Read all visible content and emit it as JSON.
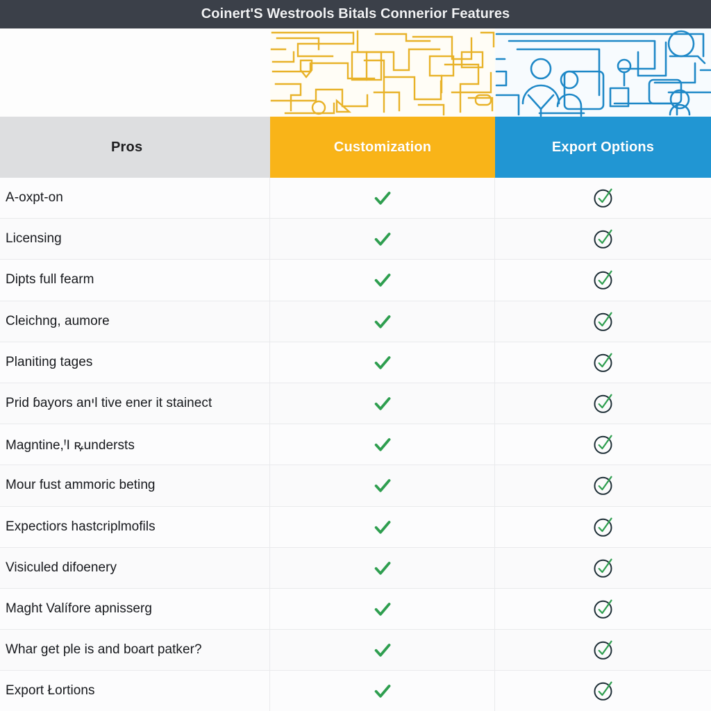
{
  "window": {
    "title": "Coinert'S Westrools Bitals Connerior Features"
  },
  "colors": {
    "titlebar_bg": "#3b4049",
    "pros_header_bg": "#dddee0",
    "customization_header_bg": "#f9b418",
    "export_header_bg": "#2196d3",
    "check_green": "#2e9e4f",
    "circle_outline": "#1a2b33",
    "banner_orange_line": "#e8b228",
    "banner_blue_line": "#1e88c7"
  },
  "banner": {
    "left_cell": "",
    "orange_art_name": "circuit-board-pattern",
    "blue_art_name": "people-network-pattern"
  },
  "table": {
    "columns": [
      {
        "key": "label",
        "label": "Pros",
        "name": "column-pros"
      },
      {
        "key": "custom",
        "label": "Customization",
        "name": "column-customization"
      },
      {
        "key": "export",
        "label": "Export Options",
        "name": "column-export-options"
      }
    ],
    "icons": {
      "customization": "check-icon",
      "export": "check-circle-icon"
    },
    "rows": [
      {
        "label": "A-oxpt-on",
        "custom": "check",
        "export": "check-circle"
      },
      {
        "label": "Licensing",
        "custom": "check",
        "export": "check-circle"
      },
      {
        "label": "Dipts full fearm",
        "custom": "check",
        "export": "check-circle"
      },
      {
        "label": "Cleichng, aumore",
        "custom": "check",
        "export": "check-circle"
      },
      {
        "label": "Planiting tages",
        "custom": "check",
        "export": "check-circle"
      },
      {
        "label": "Prid ɓayors anיl tive ener it stainect",
        "custom": "check",
        "export": "check-circle"
      },
      {
        "label": "Magntine,ꞋI ꝶundersts",
        "custom": "check",
        "export": "check-circle"
      },
      {
        "label": "Mour fust ammoric beting",
        "custom": "check",
        "export": "check-circle"
      },
      {
        "label": "Expectiors hastcriplmofils",
        "custom": "check",
        "export": "check-circle"
      },
      {
        "label": "Visiculed difoenery",
        "custom": "check",
        "export": "check-circle"
      },
      {
        "label": "Maght Valífore apnisserg",
        "custom": "check",
        "export": "check-circle"
      },
      {
        "label": "Whar get ple is and boart patker?",
        "custom": "check",
        "export": "check-circle"
      },
      {
        "label": "Export Łortions",
        "custom": "check",
        "export": "check-circle"
      }
    ]
  }
}
